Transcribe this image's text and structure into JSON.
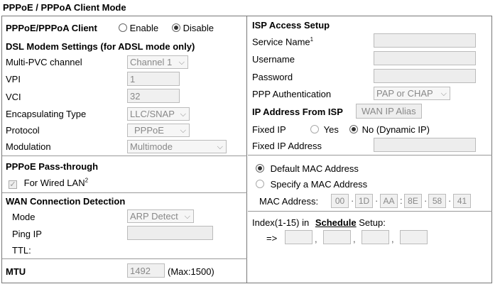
{
  "title": "PPPoE / PPPoA Client Mode",
  "left": {
    "client_label": "PPPoE/PPPoA Client",
    "enable_label": "Enable",
    "disable_label": "Disable",
    "client_selected": "Disable",
    "dsl_heading": "DSL Modem Settings (for ADSL mode only)",
    "multi_pvc_label": "Multi-PVC channel",
    "multi_pvc_value": "Channel 1",
    "vpi_label": "VPI",
    "vpi_value": "1",
    "vci_label": "VCI",
    "vci_value": "32",
    "encap_label": "Encapsulating Type",
    "encap_value": "LLC/SNAP",
    "protocol_label": "Protocol",
    "protocol_value": "PPPoE",
    "modulation_label": "Modulation",
    "modulation_value": "Multimode",
    "passthrough_heading": "PPPoE Pass-through",
    "wired_lan_label": "For Wired LAN",
    "wired_lan_sup": "2",
    "wan_heading": "WAN Connection Detection",
    "mode_label": "Mode",
    "mode_value": "ARP Detect",
    "ping_ip_label": "Ping IP",
    "ping_ip_value": "",
    "ttl_label": "TTL:",
    "mtu_label": "MTU",
    "mtu_value": "1492",
    "mtu_max": "(Max:1500)"
  },
  "right": {
    "isp_heading": "ISP Access Setup",
    "service_name_label": "Service Name",
    "service_name_sup": "1",
    "username_label": "Username",
    "password_label": "Password",
    "ppp_auth_label": "PPP Authentication",
    "ppp_auth_value": "PAP or CHAP",
    "ip_from_isp_label": "IP Address From ISP",
    "wan_ip_alias_button": "WAN IP Alias",
    "fixed_ip_label": "Fixed IP",
    "yes_label": "Yes",
    "no_label": "No (Dynamic IP)",
    "fixed_ip_selected": "No (Dynamic IP)",
    "fixed_ip_address_label": "Fixed IP Address",
    "default_mac_label": "Default MAC Address",
    "specify_mac_label": "Specify a MAC Address",
    "mac_selected": "Default MAC Address",
    "mac_address_label": "MAC Address:",
    "mac_octets": [
      "00",
      "1D",
      "AA",
      "8E",
      "58",
      "41"
    ],
    "index_label_pre": "Index(1-15) in",
    "schedule_link": "Schedule",
    "index_label_post": "Setup:",
    "arrow": "=>"
  },
  "icons": {
    "chevron": "chevron-down-icon",
    "check": "check-icon"
  }
}
